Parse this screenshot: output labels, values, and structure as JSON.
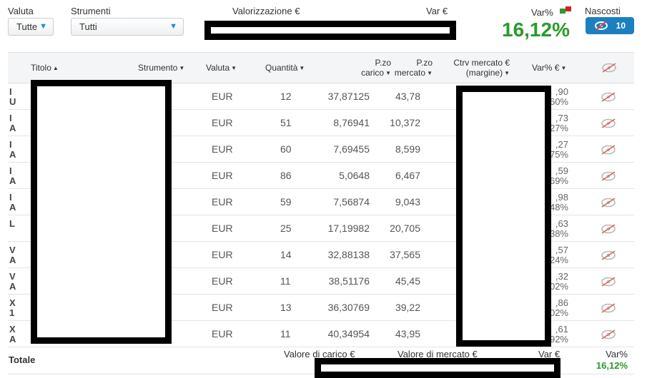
{
  "filters": {
    "valuta_label": "Valuta",
    "valuta_value": "Tutte",
    "strumenti_label": "Strumenti",
    "strumenti_value": "Tutti"
  },
  "summary": {
    "valorizzazione_label": "Valorizzazione €",
    "var_eur_label": "Var €",
    "var_pct_label": "Var%",
    "var_pct_value": "16,12%",
    "nascosti_label": "Nascosti",
    "nascosti_count": "10",
    "accent_green": "#2a9a2a",
    "accent_blue": "#1c7fbf"
  },
  "table": {
    "headers": {
      "titolo": "Titolo",
      "strumento": "Strumento",
      "valuta": "Valuta",
      "quantita": "Quantità",
      "pzo_carico_1": "P.zo",
      "pzo_carico_2": "carico",
      "pzo_mercato_1": "P.zo",
      "pzo_mercato_2": "mercato",
      "ctrv_1": "Ctrv mercato €",
      "ctrv_2": "(margine)",
      "var_pct_eur": "Var% €"
    },
    "rows": [
      {
        "t1": "I",
        "t2": "U",
        "valuta": "EUR",
        "qty": "12",
        "carico": "37,87125",
        "mercato": "43,78",
        "v1": ",90",
        "v2": ",60%"
      },
      {
        "t1": "I",
        "t2": "A",
        "valuta": "EUR",
        "qty": "51",
        "carico": "8,76941",
        "mercato": "10,372",
        "v1": ",73",
        "v2": ",27%"
      },
      {
        "t1": "I",
        "t2": "A",
        "valuta": "EUR",
        "qty": "60",
        "carico": "7,69455",
        "mercato": "8,599",
        "v1": ",27",
        "v2": ",75%"
      },
      {
        "t1": "I",
        "t2": "A",
        "valuta": "EUR",
        "qty": "86",
        "carico": "5,0648",
        "mercato": "6,467",
        "v1": ",59",
        "v2": ",69%"
      },
      {
        "t1": "I",
        "t2": "A",
        "valuta": "EUR",
        "qty": "59",
        "carico": "7,56874",
        "mercato": "9,043",
        "v1": ",98",
        "v2": ",48%"
      },
      {
        "t1": "L",
        "t2": "",
        "valuta": "EUR",
        "qty": "25",
        "carico": "17,19982",
        "mercato": "20,705",
        "v1": ",63",
        "v2": ",38%"
      },
      {
        "t1": "V",
        "t2": "A",
        "valuta": "EUR",
        "qty": "14",
        "carico": "32,88138",
        "mercato": "37,565",
        "v1": ",57",
        "v2": ",24%"
      },
      {
        "t1": "V",
        "t2": "A",
        "valuta": "EUR",
        "qty": "11",
        "carico": "38,51176",
        "mercato": "45,45",
        "v1": ",32",
        "v2": ",02%"
      },
      {
        "t1": "X",
        "t2": "1",
        "valuta": "EUR",
        "qty": "13",
        "carico": "36,30769",
        "mercato": "39,22",
        "v1": ",86",
        "v2": ",02%"
      },
      {
        "t1": "X",
        "t2": "A",
        "valuta": "EUR",
        "qty": "11",
        "carico": "40,34954",
        "mercato": "43,95",
        "v1": ",61",
        "v2": ",92%"
      }
    ]
  },
  "footer": {
    "totale_label": "Totale",
    "valore_carico_label": "Valore di carico €",
    "valore_mercato_label": "Valore di mercato €",
    "var_eur_label": "Var €",
    "var_pct_label": "Var%",
    "var_pct_value": "16,12%"
  }
}
